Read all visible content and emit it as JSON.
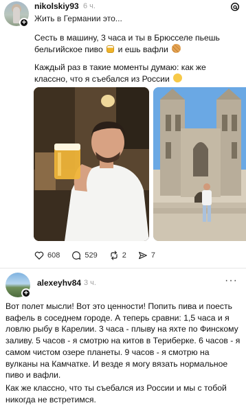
{
  "post1": {
    "username": "nikolskiy93",
    "time": "6 ч.",
    "topic": "Жить в Германии это...",
    "paragraph1": "Сесть в машину, 3 часа и ты в Брюсселе пьешь бельгийское пиво",
    "paragraph1_tail": "и ешь вафли",
    "paragraph2": "Каждый раз в такие моменты думаю: как же классно, что я съебался из России",
    "likes": "608",
    "comments": "529",
    "reposts": "2",
    "shares": "7"
  },
  "post2": {
    "username": "alexeyhv84",
    "time": "3 ч.",
    "paragraph1": "Вот полет мысли! Вот это ценности! Попить пива и поесть вафель в соседнем городе. А теперь сравни: 1,5 часа и я ловлю рыбу в Карелии.  3 часа - плыву на яхте по Финскому заливу. 5 часов - я смотрю на китов в Териберке. 6 часов - я самом чистом озере планеты. 9 часов - я смотрю на вулканы на Камчатке. И везде я могу вязать нормальное пиво и вафли.",
    "paragraph2": "Как же классно,  что ты съебался из России и мы с тобой никогда не встретимся."
  },
  "icons": {
    "like": "heart-icon",
    "comment": "comment-icon",
    "repost": "repost-icon",
    "share": "share-icon",
    "app": "threads-icon"
  }
}
